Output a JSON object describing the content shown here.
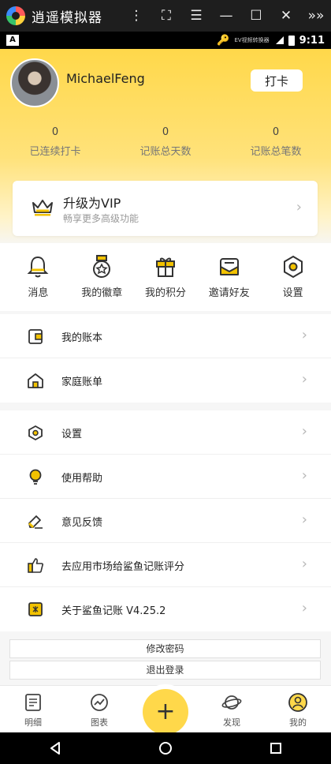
{
  "emulator": {
    "title": "逍遥模拟器",
    "controls": [
      "⋮",
      "⛶",
      "☰",
      "—",
      "☐",
      "✕",
      "»»"
    ]
  },
  "status_bar": {
    "left_badge": "A",
    "recorder_text": "EV视频转换器",
    "time": "9:11"
  },
  "profile": {
    "user_name": "MichaelFeng",
    "checkin_label": "打卡"
  },
  "stats": [
    {
      "value": "0",
      "label": "已连续打卡"
    },
    {
      "value": "0",
      "label": "记账总天数"
    },
    {
      "value": "0",
      "label": "记账总笔数"
    }
  ],
  "vip": {
    "title": "升级为VIP",
    "subtitle": "畅享更多高级功能"
  },
  "quick_icons": [
    {
      "label": "消息",
      "icon": "bell-icon"
    },
    {
      "label": "我的徽章",
      "icon": "badge-icon"
    },
    {
      "label": "我的积分",
      "icon": "gift-icon"
    },
    {
      "label": "邀请好友",
      "icon": "envelope-icon"
    },
    {
      "label": "设置",
      "icon": "hexagon-settings-icon"
    }
  ],
  "list_group_1": [
    {
      "label": "我的账本",
      "icon": "wallet-icon"
    },
    {
      "label": "家庭账单",
      "icon": "home-icon"
    }
  ],
  "list_group_2": [
    {
      "label": "设置",
      "icon": "hexagon-settings-icon"
    },
    {
      "label": "使用帮助",
      "icon": "lightbulb-icon"
    },
    {
      "label": "意见反馈",
      "icon": "eraser-icon"
    },
    {
      "label": "去应用市场给鲨鱼记账评分",
      "icon": "thumbs-up-icon"
    },
    {
      "label": "关于鲨鱼记账 V4.25.2",
      "icon": "app-logo-icon"
    }
  ],
  "actions": {
    "change_password": "修改密码",
    "logout": "退出登录"
  },
  "bottom_nav": [
    {
      "label": "明细",
      "icon": "list-icon"
    },
    {
      "label": "图表",
      "icon": "chart-icon"
    },
    {
      "label": "发现",
      "icon": "planet-icon"
    },
    {
      "label": "我的",
      "icon": "profile-icon"
    }
  ],
  "fab_label": "+",
  "colors": {
    "accent": "#ffd84a",
    "accent_dark": "#f2c200"
  }
}
